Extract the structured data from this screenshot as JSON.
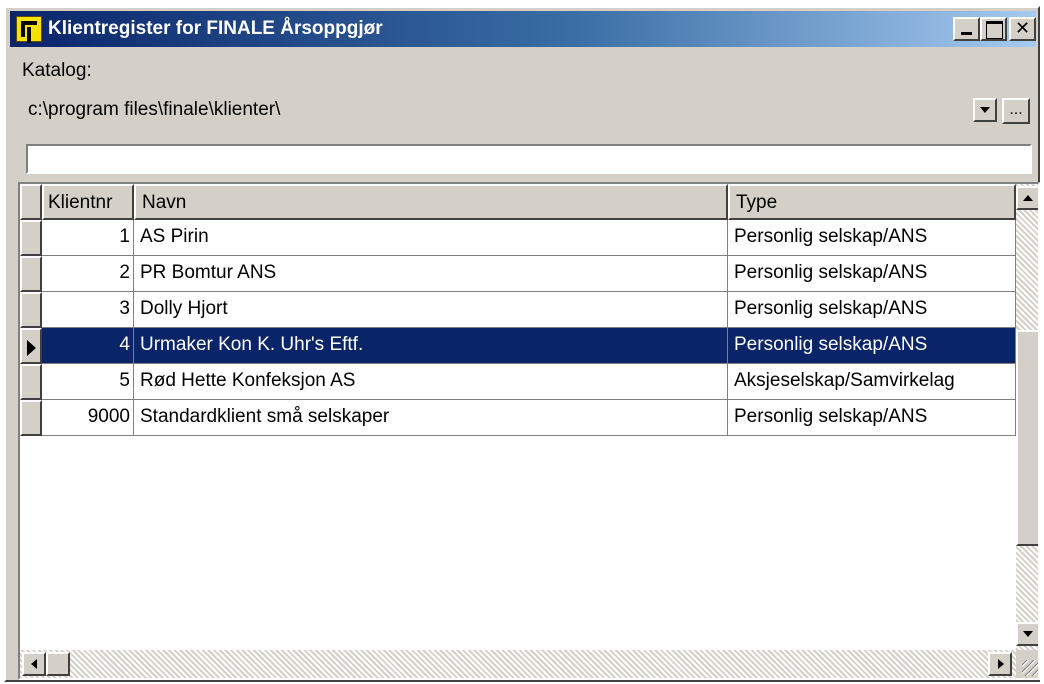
{
  "window": {
    "title": "Klientregister for FINALE Årsoppgjør",
    "close_glyph": "✕"
  },
  "katalog": {
    "label": "Katalog:",
    "value": "c:\\program files\\finale\\klienter\\",
    "browse_label": "..."
  },
  "search": {
    "value": ""
  },
  "grid": {
    "columns": [
      "Klientnr",
      "Navn",
      "Type"
    ],
    "selected_index": 3,
    "rows": [
      {
        "nr": "1",
        "navn": "AS Pirin",
        "type": "Personlig selskap/ANS"
      },
      {
        "nr": "2",
        "navn": "PR Bomtur ANS",
        "type": "Personlig selskap/ANS"
      },
      {
        "nr": "3",
        "navn": "Dolly Hjort",
        "type": "Personlig selskap/ANS"
      },
      {
        "nr": "4",
        "navn": "Urmaker Kon K. Uhr's Eftf.",
        "type": "Personlig selskap/ANS"
      },
      {
        "nr": "5",
        "navn": "Rød Hette Konfeksjon AS",
        "type": "Aksjeselskap/Samvirkelag"
      },
      {
        "nr": "9000",
        "navn": "Standardklient små selskaper",
        "type": "Personlig selskap/ANS"
      }
    ]
  },
  "colors": {
    "titlebar_start": "#0a246a",
    "titlebar_end": "#a6caf0",
    "selection": "#0a246a",
    "face": "#d4d0c8"
  }
}
